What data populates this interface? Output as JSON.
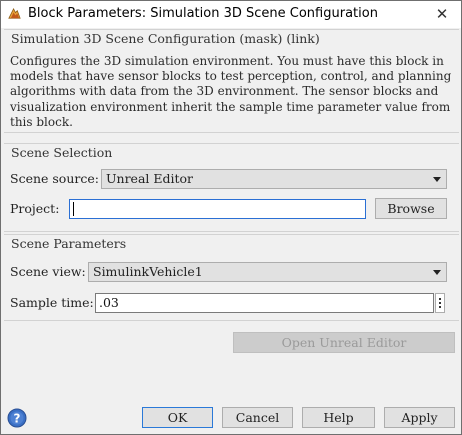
{
  "window": {
    "title": "Block Parameters: Simulation 3D Scene Configuration",
    "close_glyph": "✕"
  },
  "description": {
    "heading": "Simulation 3D Scene Configuration (mask) (link)",
    "text": "Configures the 3D simulation environment. You must have this block in models that have sensor blocks to test perception, control, and planning algorithms with data from the 3D environment. The sensor blocks and visualization environment inherit the sample time parameter value from this block."
  },
  "scene_selection": {
    "heading": "Scene Selection",
    "source_label": "Scene source:",
    "source_value": "Unreal Editor",
    "project_label": "Project:",
    "project_value": "",
    "browse_label": "Browse"
  },
  "scene_parameters": {
    "heading": "Scene Parameters",
    "view_label": "Scene view:",
    "view_value": "SimulinkVehicle1",
    "sample_time_label": "Sample time:",
    "sample_time_value": ".03",
    "open_editor_label": "Open Unreal Editor"
  },
  "footer": {
    "ok": "OK",
    "cancel": "Cancel",
    "help": "Help",
    "apply": "Apply"
  },
  "icons": {
    "window_icon": "simulink-block-icon",
    "help_icon": "question-mark-icon",
    "more_icon": "vertical-ellipsis-icon"
  },
  "colors": {
    "window_bg": "#f0f0f0",
    "button_bg": "#e1e1e1",
    "focus_border": "#2a6fd4",
    "help_icon_blue": "#3a6fc4"
  }
}
